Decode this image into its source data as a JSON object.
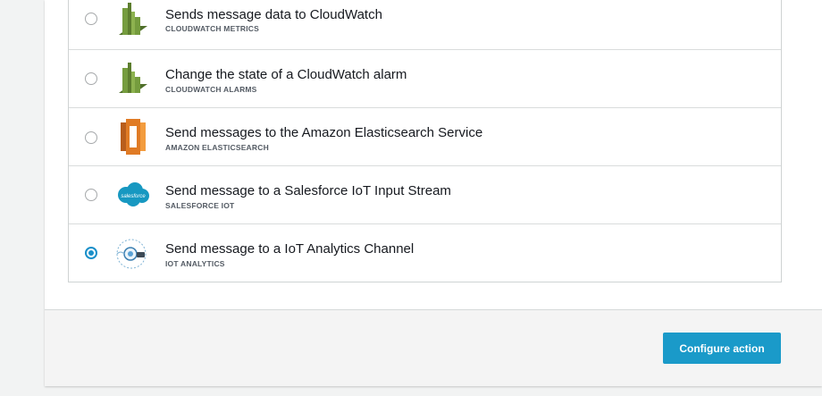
{
  "actions": [
    {
      "title": "Sends message data to CloudWatch",
      "subtitle": "CLOUDWATCH METRICS",
      "icon": "cloudwatch-metrics-icon",
      "selected": false
    },
    {
      "title": "Change the state of a CloudWatch alarm",
      "subtitle": "CLOUDWATCH ALARMS",
      "icon": "cloudwatch-alarms-icon",
      "selected": false
    },
    {
      "title": "Send messages to the Amazon Elasticsearch Service",
      "subtitle": "AMAZON ELASTICSEARCH",
      "icon": "elasticsearch-icon",
      "selected": false
    },
    {
      "title": "Send message to a Salesforce IoT Input Stream",
      "subtitle": "SALESFORCE IOT",
      "icon": "salesforce-icon",
      "salesforce_logo_text": "salesforce",
      "selected": false
    },
    {
      "title": "Send message to a IoT Analytics Channel",
      "subtitle": "IOT ANALYTICS",
      "icon": "iot-analytics-icon",
      "selected": true
    }
  ],
  "footer": {
    "configure_label": "Configure action"
  },
  "colors": {
    "accent": "#1a9ac9",
    "cloudwatch_green": "#759c3e",
    "elasticsearch_orange": "#e07b25",
    "salesforce_blue": "#1798c1"
  }
}
